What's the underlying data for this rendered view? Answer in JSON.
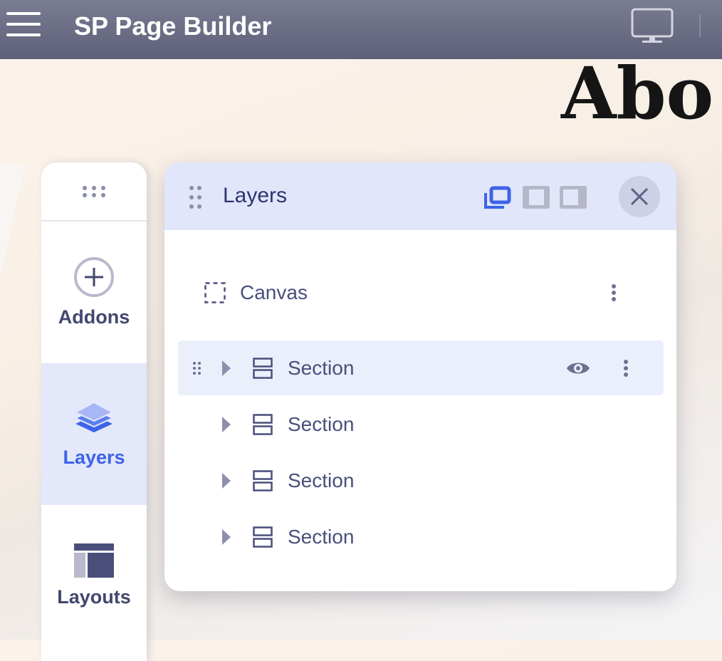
{
  "topbar": {
    "title": "SP Page Builder"
  },
  "page": {
    "hero_text": "Abo"
  },
  "sidebar": {
    "items": [
      {
        "label": "Addons"
      },
      {
        "label": "Layers"
      },
      {
        "label": "Layouts"
      }
    ]
  },
  "layers_panel": {
    "title": "Layers",
    "canvas_label": "Canvas",
    "sections": [
      {
        "label": "Section"
      },
      {
        "label": "Section"
      },
      {
        "label": "Section"
      },
      {
        "label": "Section"
      }
    ]
  },
  "colors": {
    "accent": "#3d63e8",
    "text": "#43476e"
  }
}
